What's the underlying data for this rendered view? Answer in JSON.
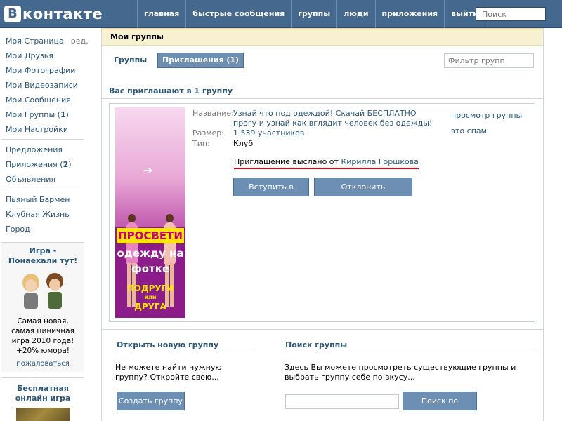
{
  "header": {
    "logo_letter": "B",
    "logo_text": "контакте",
    "nav": [
      "главная",
      "быстрые сообщения",
      "группы",
      "люди",
      "приложения",
      "выйти"
    ],
    "search_placeholder": "Поиск"
  },
  "sidebar": {
    "profile": {
      "label": "Моя Страница",
      "edit": "ред."
    },
    "items": [
      {
        "label": "Мои Друзья"
      },
      {
        "label": "Мои Фотографии"
      },
      {
        "label": "Мои Видеозаписи"
      },
      {
        "label": "Мои Сообщения"
      },
      {
        "label": "Мои Группы",
        "count": "1"
      },
      {
        "label": "Мои Настройки"
      }
    ],
    "items2": [
      {
        "label": "Предложения"
      },
      {
        "label": "Приложения",
        "count": "2"
      },
      {
        "label": "Объявления"
      }
    ],
    "items3": [
      {
        "label": "Пьяный Бармен"
      },
      {
        "label": "Клубная Жизнь"
      },
      {
        "label": "Город"
      }
    ],
    "promo": {
      "title": "Игра - Понаехали тут!",
      "text": "Самая новая, самая циничная игра 2010 года! +20% юмора!",
      "link": "пожаловаться"
    },
    "promo2": {
      "title": "Бесплатная онлайн игра"
    }
  },
  "main": {
    "page_title": "Мои группы",
    "tabs": {
      "groups": "Группы",
      "invites": "Приглашения (1)"
    },
    "filter_placeholder": "Фильтр групп",
    "section_title": "Вас приглашают в 1 группу",
    "invite": {
      "banner": {
        "line1": "ПРОСВЕТИ",
        "line2": "одежду на фотке",
        "line3": "ПОДРУГИ",
        "line3_small": "или",
        "line4": "ДРУГА"
      },
      "name_label": "Название:",
      "name_value": "Узнай что под одеждой! Скачай БЕСПЛАТНО прогу и узнай как вглядит человек без одежды!",
      "size_label": "Размер:",
      "size_value": "1 539 участников",
      "type_label": "Тип:",
      "type_value": "Клуб",
      "view_link": "просмотр группы",
      "spam_link": "это спам",
      "sent_text": "Приглашение выслано от",
      "sent_from": "Кирилла Горшкова",
      "join_button": "Вступить в группу",
      "decline_button": "Отклонить приглашение"
    },
    "create": {
      "title": "Открыть новую группу",
      "text": "Не можете найти нужную группу? Откройте свою...",
      "button": "Создать группу"
    },
    "search": {
      "title": "Поиск группы",
      "text": "Здесь Вы можете просмотреть существующие группы и выбрать группу себе по вкусу...",
      "button": "Поиск по группам"
    }
  },
  "colors": {
    "header_bg": "#45688e",
    "link": "#2b587a",
    "button_bg": "#6d8fb3",
    "notice_bg": "#f7f1d1",
    "underline": "#e0001a"
  }
}
